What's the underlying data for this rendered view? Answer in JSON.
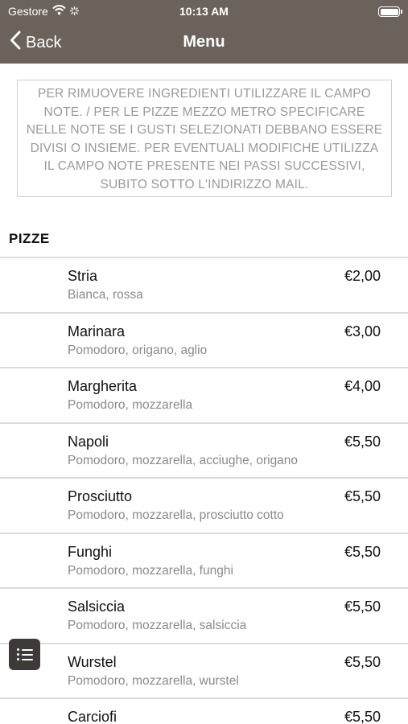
{
  "status": {
    "carrier": "Gestore",
    "time": "10:13 AM",
    "battery": 1.0
  },
  "nav": {
    "back_label": "Back",
    "title": "Menu"
  },
  "notice": "PER RIMUOVERE INGREDIENTI UTILIZZARE IL CAMPO NOTE. / PER LE PIZZE MEZZO METRO SPECIFICARE NELLE NOTE SE I GUSTI SELEZIONATI DEBBANO ESSERE DIVISI O INSIEME. PER EVENTUALI MODIFICHE UTILIZZA IL CAMPO NOTE PRESENTE NEI PASSI SUCCESSIVI, SUBITO SOTTO L'INDIRIZZO MAIL.",
  "section": {
    "title": "PIZZE"
  },
  "items": [
    {
      "name": "Stria",
      "desc": "Bianca, rossa",
      "price": "€2,00"
    },
    {
      "name": "Marinara",
      "desc": "Pomodoro, origano, aglio",
      "price": "€3,00"
    },
    {
      "name": "Margherita",
      "desc": "Pomodoro, mozzarella",
      "price": "€4,00"
    },
    {
      "name": "Napoli",
      "desc": "Pomodoro, mozzarella, acciughe, origano",
      "price": "€5,50"
    },
    {
      "name": "Prosciutto",
      "desc": "Pomodoro, mozzarella, prosciutto cotto",
      "price": "€5,50"
    },
    {
      "name": "Funghi",
      "desc": "Pomodoro, mozzarella, funghi",
      "price": "€5,50"
    },
    {
      "name": "Salsiccia",
      "desc": "Pomodoro, mozzarella, salsiccia",
      "price": "€5,50"
    },
    {
      "name": "Wurstel",
      "desc": "Pomodoro, mozzarella, wurstel",
      "price": "€5,50"
    },
    {
      "name": "Carciofi",
      "desc": "",
      "price": "€5,50"
    }
  ],
  "icons": {
    "back": "chevron-left-icon",
    "wifi": "wifi-icon",
    "activity": "activity-spinner-icon",
    "fab": "list-menu-icon"
  },
  "colors": {
    "header": "#6b625c",
    "fab": "#3d3a38",
    "muted": "#8a8a8a",
    "divider": "#dcdcdc"
  }
}
